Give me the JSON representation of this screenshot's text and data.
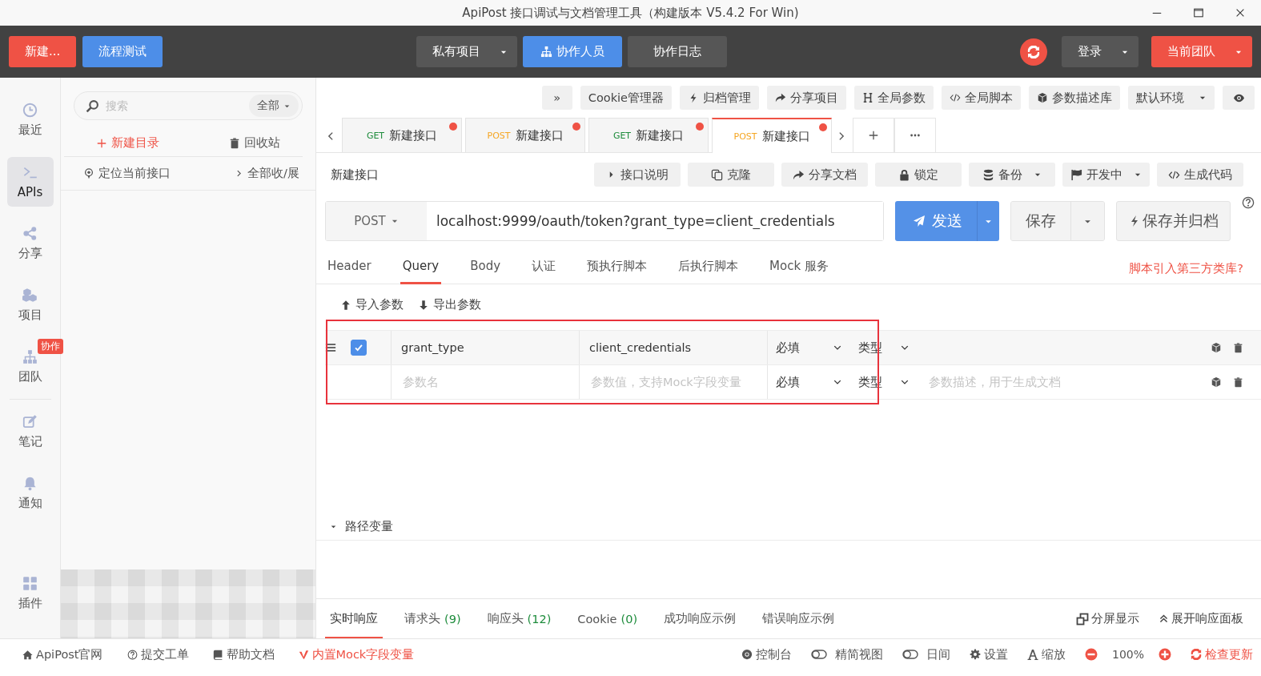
{
  "window": {
    "title": "ApiPost 接口调试与文档管理工具（构建版本 V5.4.2 For Win)"
  },
  "topbar": {
    "left": [
      {
        "label": "新建...",
        "kind": "danger",
        "dropdown": false
      },
      {
        "label": "流程测试",
        "kind": "primary",
        "dropdown": false
      }
    ],
    "center": [
      {
        "label": "私有项目",
        "kind": "dark",
        "dropdown": true
      },
      {
        "label": "协作人员",
        "kind": "primary",
        "dropdown": false
      },
      {
        "label": "协作日志",
        "kind": "dark",
        "dropdown": false
      }
    ],
    "right": [
      {
        "label": "登录",
        "kind": "dark",
        "dropdown": true
      },
      {
        "label": "当前团队",
        "kind": "danger",
        "dropdown": true
      }
    ]
  },
  "rail": [
    {
      "label": "最近",
      "selected": false
    },
    {
      "label": "APIs",
      "selected": true
    },
    {
      "label": "分享",
      "selected": false
    },
    {
      "label": "项目",
      "selected": false
    },
    {
      "label": "团队",
      "selected": false,
      "badge": "协作"
    },
    {
      "label": "笔记",
      "selected": false
    },
    {
      "label": "通知",
      "selected": false
    },
    {
      "label": "插件",
      "selected": false
    }
  ],
  "sidebar": {
    "search": {
      "placeholder": "搜索",
      "filter": "全部"
    },
    "actions": [
      {
        "label": "新建目录",
        "kind": "accent"
      },
      {
        "label": "回收站",
        "kind": "plain"
      },
      {
        "label": "定位当前接口",
        "kind": "plain"
      },
      {
        "label": "全部收/展",
        "kind": "plain"
      }
    ]
  },
  "toolbar": [
    {
      "label": "»",
      "dropdown": false
    },
    {
      "label": "Cookie管理器",
      "dropdown": false
    },
    {
      "label": "归档管理",
      "dropdown": false
    },
    {
      "label": "分享项目",
      "dropdown": false
    },
    {
      "label": "全局参数",
      "dropdown": false
    },
    {
      "label": "全局脚本",
      "dropdown": false
    },
    {
      "label": "参数描述库",
      "dropdown": false
    },
    {
      "label": "默认环境",
      "dropdown": true
    }
  ],
  "request_tabs": [
    {
      "method": "GET",
      "color": "#1e8c3c",
      "title": "新建接口",
      "selected": false,
      "unsaved": true
    },
    {
      "method": "POST",
      "color": "#f5a623",
      "title": "新建接口",
      "selected": false,
      "unsaved": true
    },
    {
      "method": "GET",
      "color": "#1e8c3c",
      "title": "新建接口",
      "selected": false,
      "unsaved": true
    },
    {
      "method": "POST",
      "color": "#f5a623",
      "title": "新建接口",
      "selected": true,
      "unsaved": true
    }
  ],
  "request": {
    "title": "新建接口",
    "actions": [
      {
        "label": "接口说明",
        "dropdown": false
      },
      {
        "label": "克隆",
        "dropdown": false
      },
      {
        "label": "分享文档",
        "dropdown": false
      },
      {
        "label": "锁定",
        "dropdown": false
      },
      {
        "label": "备份",
        "dropdown": true
      },
      {
        "label": "开发中",
        "dropdown": true
      },
      {
        "label": "生成代码",
        "dropdown": false
      }
    ],
    "method": "POST",
    "url": "localhost:9999/oauth/token?grant_type=client_credentials",
    "send": "发送",
    "save": "保存",
    "save_archive": "保存并归档"
  },
  "param_tabs": [
    {
      "label": "Header",
      "selected": false
    },
    {
      "label": "Query",
      "selected": true
    },
    {
      "label": "Body",
      "selected": false
    },
    {
      "label": "认证",
      "selected": false
    },
    {
      "label": "预执行脚本",
      "selected": false
    },
    {
      "label": "后执行脚本",
      "selected": false
    },
    {
      "label": "Mock 服务",
      "selected": false
    }
  ],
  "script_link": "脚本引入第三方类库?",
  "params": {
    "import": "导入参数",
    "export": "导出参数",
    "rows": [
      {
        "kind": "param",
        "checked": true,
        "key": "grant_type",
        "value": "client_credentials",
        "required": "必填",
        "type": "类型"
      },
      {
        "kind": "new",
        "key_placeholder": "参数名",
        "value_placeholder": "参数值，支持Mock字段变量",
        "required": "必填",
        "type": "类型",
        "description_placeholder": "参数描述，用于生成文档"
      }
    ]
  },
  "path_variables": {
    "label": "路径变量",
    "expanded": true
  },
  "response_tabs": [
    {
      "label": "实时响应",
      "selected": true
    },
    {
      "label": "请求头",
      "count": "(9)",
      "selected": false
    },
    {
      "label": "响应头",
      "count": "(12)",
      "selected": false
    },
    {
      "label": "Cookie",
      "count": "(0)",
      "selected": false
    },
    {
      "label": "成功响应示例",
      "selected": false
    },
    {
      "label": "错误响应示例",
      "selected": false
    }
  ],
  "response_actions": [
    "分屏显示",
    "展开响应面板"
  ],
  "status_bar": {
    "left": [
      {
        "label": "ApiPost官网",
        "kind": "plain"
      },
      {
        "label": "提交工单",
        "kind": "plain"
      },
      {
        "label": "帮助文档",
        "kind": "plain"
      },
      {
        "label": "内置Mock字段变量",
        "kind": "accent"
      }
    ],
    "right": [
      {
        "label": "控制台",
        "kind": "plain"
      },
      {
        "label": "精简视图",
        "kind": "toggle",
        "on": false
      },
      {
        "label": "日间",
        "kind": "toggle",
        "on": false
      },
      {
        "label": "设置",
        "kind": "plain"
      },
      {
        "label": "缩放",
        "kind": "plain"
      }
    ],
    "zoom": "100%",
    "update": "检查更新"
  }
}
